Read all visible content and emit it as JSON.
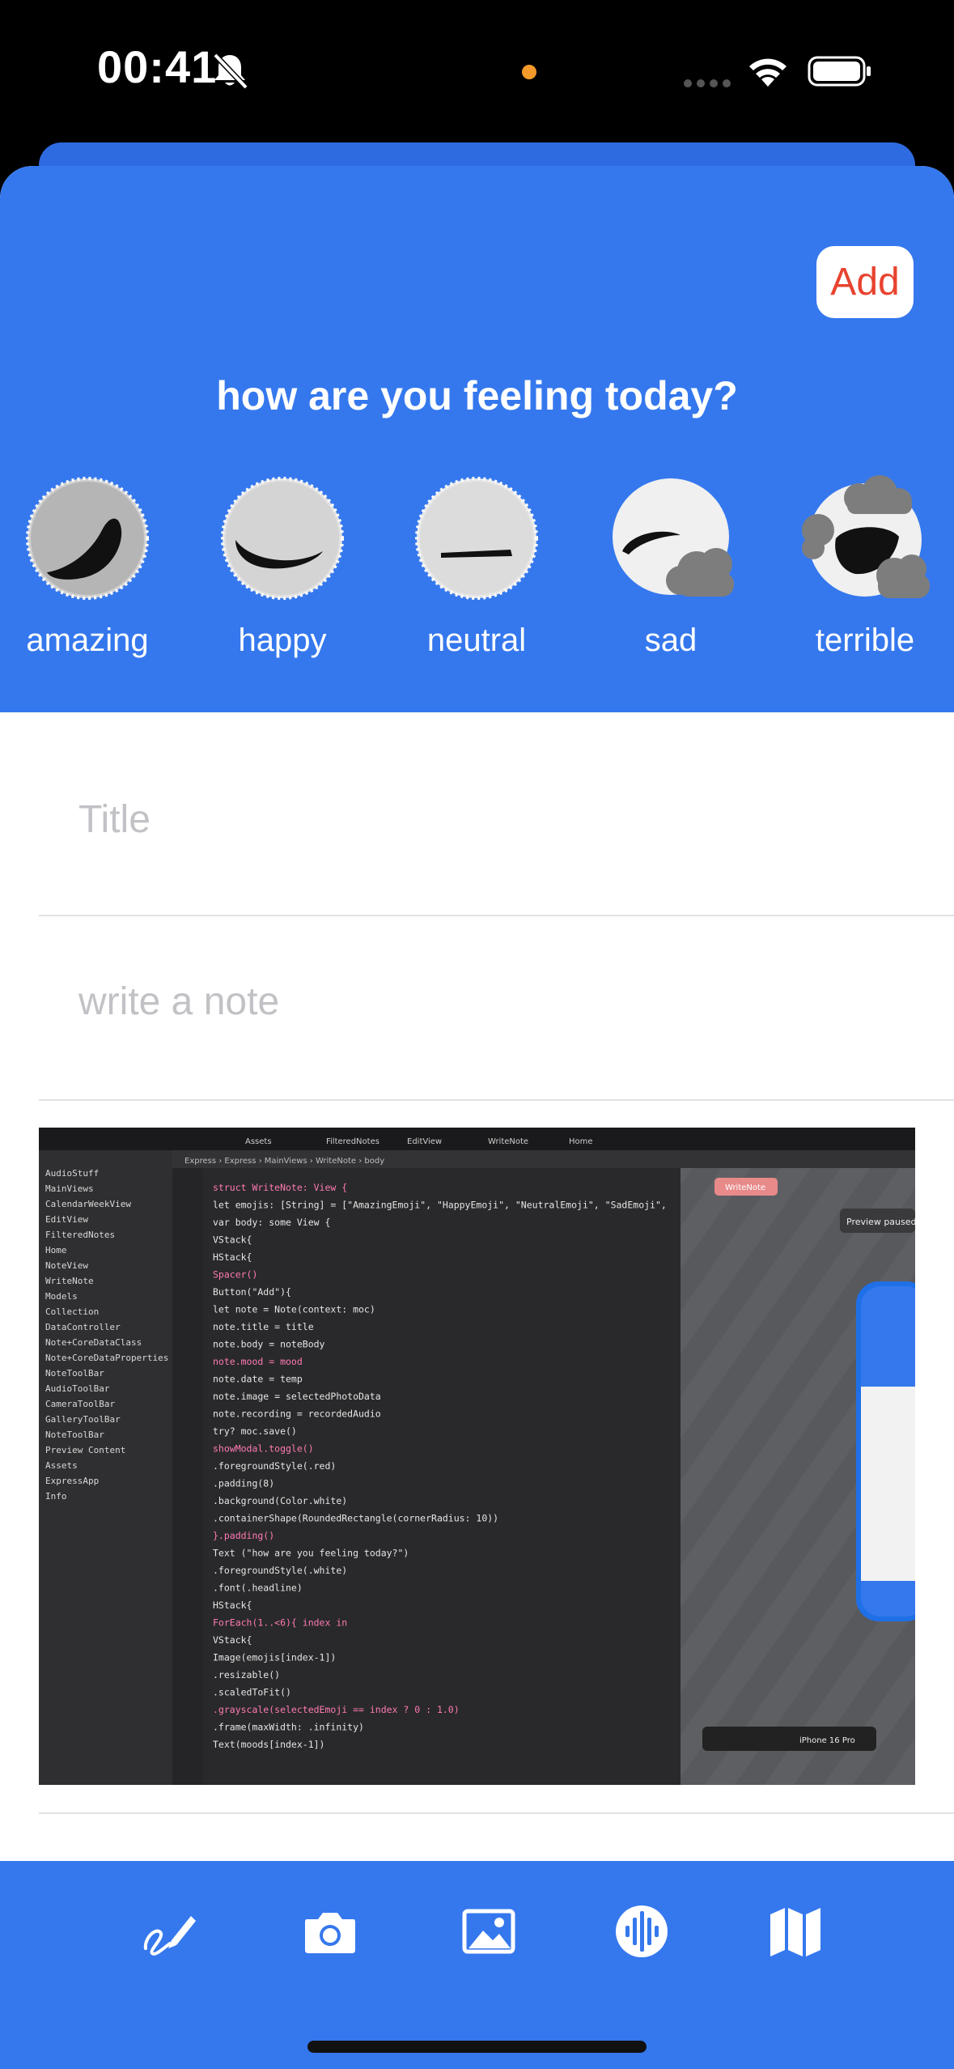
{
  "status_bar": {
    "time": "00:41"
  },
  "header": {
    "add_label": "Add",
    "question": "how are you feeling today?",
    "moods": [
      {
        "label": "amazing",
        "selected": true
      },
      {
        "label": "happy",
        "selected": false
      },
      {
        "label": "neutral",
        "selected": false
      },
      {
        "label": "sad",
        "selected": false
      },
      {
        "label": "terrible",
        "selected": false
      }
    ]
  },
  "form": {
    "title_placeholder": "Title",
    "note_placeholder": "write a note"
  },
  "photo": {
    "code_lines": [
      "struct WriteNote: View {",
      "  let emojis: [String] = [\"AmazingEmoji\", \"HappyEmoji\", \"NeutralEmoji\", \"SadEmoji\",",
      "  var body: some View {",
      "    VStack{",
      "      HStack{",
      "        Spacer()",
      "        Button(\"Add\"){",
      "          let note = Note(context: moc)",
      "          note.title = title",
      "          note.body = noteBody",
      "          note.mood = mood",
      "          note.date = temp",
      "          note.image = selectedPhotoData",
      "          note.recording = recordedAudio",
      "          try? moc.save()",
      "          showModal.toggle()",
      "        .foregroundStyle(.red)",
      "        .padding(8)",
      "        .background(Color.white)",
      "        .containerShape(RoundedRectangle(cornerRadius: 10))",
      "      }.padding()",
      "      Text (\"how are you feeling today?\")",
      "        .foregroundStyle(.white)",
      "        .font(.headline)",
      "      HStack{",
      "        ForEach(1..<6){ index in",
      "          VStack{",
      "            Image(emojis[index-1])",
      "              .resizable()",
      "              .scaledToFit()",
      "              .grayscale(selectedEmoji == index ? 0 : 1.0)",
      "              .frame(maxWidth: .infinity)",
      "            Text(moods[index-1])"
    ],
    "sidebar_items": [
      "AudioStuff",
      "MainViews",
      "CalendarWeekView",
      "EditView",
      "FilteredNotes",
      "Home",
      "NoteView",
      "WriteNote",
      "Models",
      "Collection",
      "DataController",
      "Note+CoreDataClass",
      "Note+CoreDataProperties",
      "NoteToolBar",
      "AudioToolBar",
      "CameraToolBar",
      "GalleryToolBar",
      "NoteToolBar",
      "Preview Content",
      "Assets",
      "ExpressApp",
      "Info"
    ],
    "tabs": [
      "Assets",
      "FilteredNotes",
      "EditView",
      "WriteNote",
      "Home"
    ],
    "breadcrumb": "Express › Express › MainViews › WriteNote › body",
    "preview_label": "Preview paused",
    "device_label": "iPhone 16 Pro",
    "preview_tag": "WriteNote"
  },
  "toolbar": {
    "icons": [
      "pen-scribble-icon",
      "camera-icon",
      "photo-icon",
      "waveform-icon",
      "map-icon"
    ]
  },
  "colors": {
    "header_blue": "#3578ee",
    "add_red": "#e8432f"
  }
}
